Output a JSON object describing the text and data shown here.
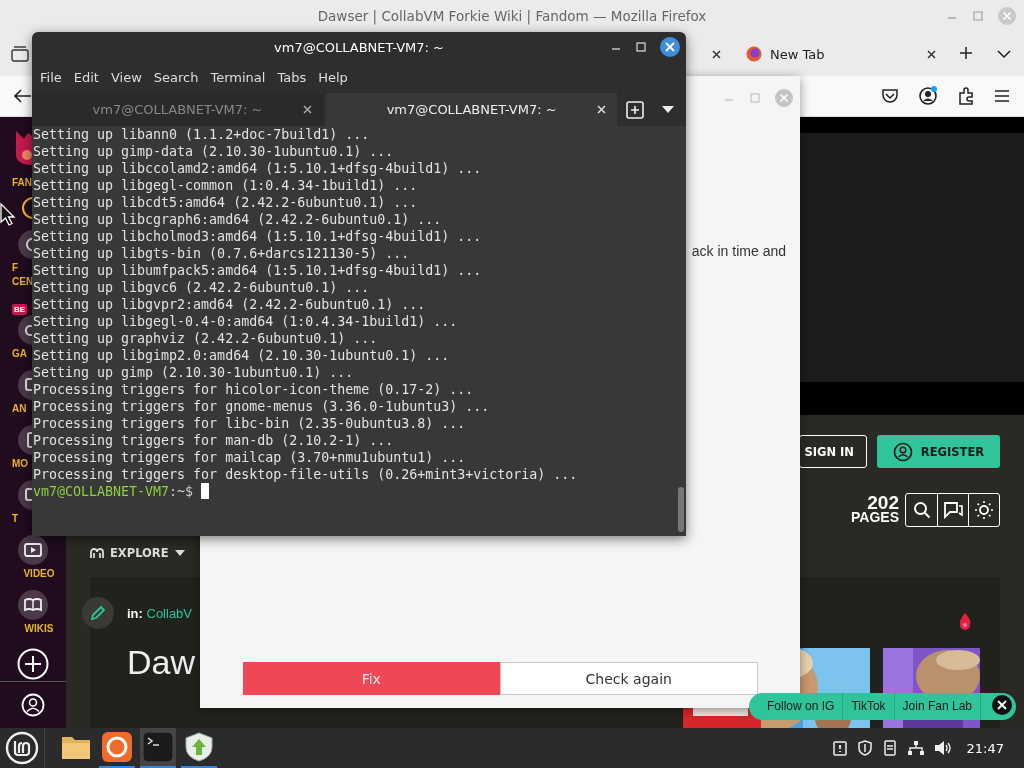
{
  "firefox": {
    "title": "Dawser | CollabVM Forkie Wiki | Fandom — Mozilla Firefox",
    "tabs": [
      {
        "label": "New Tab",
        "selected": false
      }
    ]
  },
  "fandom": {
    "sidebar": [
      {
        "kind": "logo",
        "labels": [
          "FAN"
        ]
      },
      {
        "kind": "ring"
      },
      {
        "kind": "icon",
        "labels": [
          "F",
          "CEN"
        ],
        "badge": "BE"
      },
      {
        "kind": "icon",
        "labels": [
          "GA"
        ]
      },
      {
        "kind": "icon",
        "labels": [
          "AN"
        ]
      },
      {
        "kind": "icon",
        "labels": [
          "MO"
        ]
      },
      {
        "kind": "icon",
        "labels": [
          "T"
        ]
      },
      {
        "kind": "icon",
        "labels": [
          "VIDEO"
        ]
      },
      {
        "kind": "icon",
        "labels": [
          "WIKIS"
        ]
      },
      {
        "kind": "create"
      }
    ],
    "sign_in": "SIGN IN",
    "register": "REGISTER",
    "page_count": "202",
    "page_count_label": "PAGES",
    "explore": "EXPLORE",
    "breadcrumb_prefix": "in:",
    "breadcrumb_link": "CollabV",
    "page_title": "Daw",
    "social": [
      "Follow on IG",
      "TikTok",
      "Join Fan Lab"
    ]
  },
  "dialog": {
    "text": "ack in time and",
    "buttons": [
      {
        "label": "Fix",
        "kind": "primary"
      },
      {
        "label": "Check again",
        "kind": "secondary"
      }
    ]
  },
  "terminal": {
    "title": "vm7@COLLABNET-VM7: ~",
    "menu": [
      "File",
      "Edit",
      "View",
      "Search",
      "Terminal",
      "Tabs",
      "Help"
    ],
    "tabs": [
      {
        "label": "vm7@COLLABNET-VM7: ~",
        "selected": false
      },
      {
        "label": "vm7@COLLABNET-VM7: ~",
        "selected": true
      }
    ],
    "lines": [
      "Setting up libann0 (1.1.2+doc-7build1) ...",
      "Setting up gimp-data (2.10.30-1ubuntu0.1) ...",
      "Setting up libccolamd2:amd64 (1:5.10.1+dfsg-4build1) ...",
      "Setting up libgegl-common (1:0.4.34-1build1) ...",
      "Setting up libcdt5:amd64 (2.42.2-6ubuntu0.1) ...",
      "Setting up libcgraph6:amd64 (2.42.2-6ubuntu0.1) ...",
      "Setting up libcholmod3:amd64 (1:5.10.1+dfsg-4build1) ...",
      "Setting up libgts-bin (0.7.6+darcs121130-5) ...",
      "Setting up libumfpack5:amd64 (1:5.10.1+dfsg-4build1) ...",
      "Setting up libgvc6 (2.42.2-6ubuntu0.1) ...",
      "Setting up libgvpr2:amd64 (2.42.2-6ubuntu0.1) ...",
      "Setting up libgegl-0.4-0:amd64 (1:0.4.34-1build1) ...",
      "Setting up graphviz (2.42.2-6ubuntu0.1) ...",
      "Setting up libgimp2.0:amd64 (2.10.30-1ubuntu0.1) ...",
      "Setting up gimp (2.10.30-1ubuntu0.1) ...",
      "Processing triggers for hicolor-icon-theme (0.17-2) ...",
      "Processing triggers for gnome-menus (3.36.0-1ubuntu3) ...",
      "Processing triggers for libc-bin (2.35-0ubuntu3.8) ...",
      "Processing triggers for man-db (2.10.2-1) ...",
      "Processing triggers for mailcap (3.70+nmu1ubuntu1) ...",
      "Processing triggers for desktop-file-utils (0.26+mint3+victoria) ..."
    ],
    "prompt_user": "vm7@COLLABNET-VM7",
    "prompt_path": ":~$"
  },
  "taskbar": {
    "apps": [
      {
        "kind": "folder",
        "running": false,
        "selected": false
      },
      {
        "kind": "browser",
        "running": true,
        "selected": false
      },
      {
        "kind": "terminal",
        "running": true,
        "selected": true
      },
      {
        "kind": "update",
        "running": true,
        "selected": false
      }
    ],
    "clock": "21:47"
  }
}
